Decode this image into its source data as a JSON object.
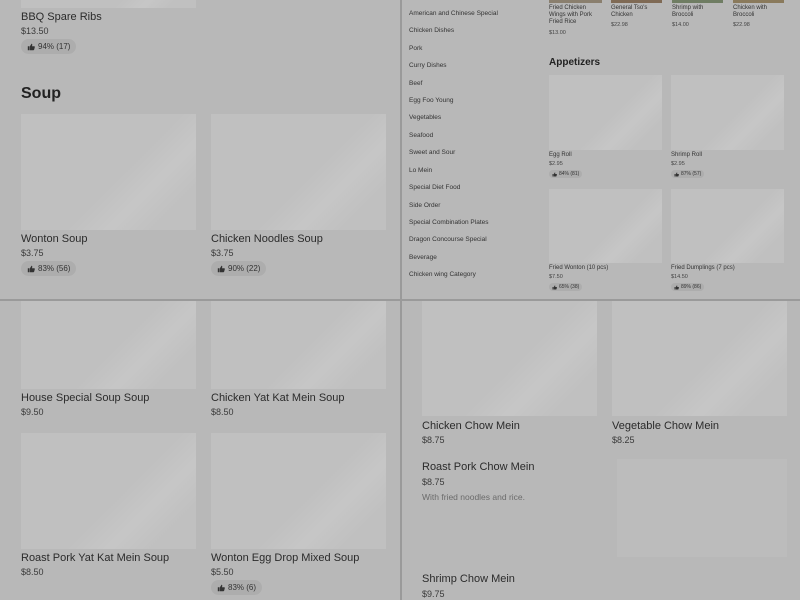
{
  "q_tl": {
    "top_item": {
      "name": "BBQ Spare Ribs",
      "price": "$13.50",
      "rating": "94% (17)"
    },
    "section_title": "Soup",
    "items": [
      {
        "name": "Wonton Soup",
        "price": "$3.75",
        "rating": "83% (56)"
      },
      {
        "name": "Chicken Noodles Soup",
        "price": "$3.75",
        "rating": "90% (22)"
      }
    ]
  },
  "q_tr": {
    "categories": [
      "American and Chinese Special",
      "Chicken Dishes",
      "Pork",
      "Curry Dishes",
      "Beef",
      "Egg Foo Young",
      "Vegetables",
      "Seafood",
      "Sweet and Sour",
      "Lo Mein",
      "Special Diet Food",
      "Side Order",
      "Special Combination Plates",
      "Dragon Concourse Special",
      "Beverage",
      "Chicken wing Category"
    ],
    "featured": [
      {
        "name": "Fried Chicken Wings with Pork Fried Rice",
        "price": "$13.00"
      },
      {
        "name": "General Tso's Chicken",
        "price": "$22.98"
      },
      {
        "name": "Shrimp with Broccoli",
        "price": "$14.00"
      },
      {
        "name": "Chicken with Broccoli",
        "price": "$22.98"
      }
    ],
    "section_title": "Appetizers",
    "appetizers": [
      {
        "name": "Egg Roll",
        "price": "$2.95",
        "rating": "84% (81)"
      },
      {
        "name": "Shrimp Roll",
        "price": "$2.95",
        "rating": "87% (57)"
      },
      {
        "name": "Fried Wonton (10 pcs)",
        "price": "$7.50",
        "rating": "65% (38)"
      },
      {
        "name": "Fried Dumplings (7 pcs)",
        "price": "$14.50",
        "rating": "89% (86)"
      }
    ]
  },
  "q_bl": {
    "items": [
      {
        "name": "House Special Soup Soup",
        "price": "$9.50"
      },
      {
        "name": "Chicken Yat Kat Mein Soup",
        "price": "$8.50"
      },
      {
        "name": "Roast Pork Yat Kat Mein Soup",
        "price": "$8.50"
      },
      {
        "name": "Wonton Egg Drop Mixed Soup",
        "price": "$5.50",
        "rating": "83% (6)"
      }
    ]
  },
  "q_br": {
    "items": [
      {
        "name": "Chicken Chow Mein",
        "price": "$8.75"
      },
      {
        "name": "Vegetable Chow Mein",
        "price": "$8.25"
      },
      {
        "name": "Roast Pork Chow Mein",
        "price": "$8.75",
        "description": "With fried noodles and rice."
      },
      {
        "name": "Shrimp Chow Mein",
        "price": "$9.75"
      }
    ]
  },
  "icons": {
    "thumbs_up": "thumbs-up-icon"
  },
  "colors": {
    "overlay": "#b8b8b8",
    "divider": "#ffffff",
    "placeholder": "#c0c0c0",
    "badge": "#adadad"
  }
}
